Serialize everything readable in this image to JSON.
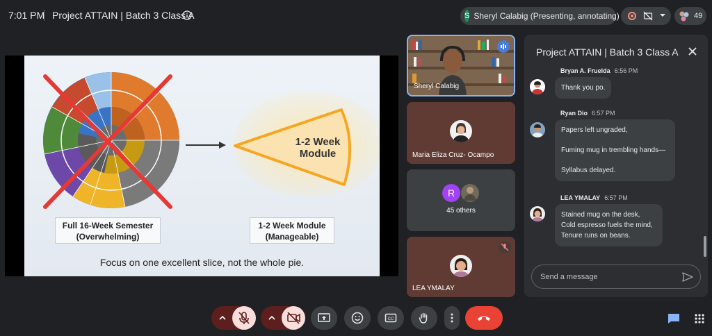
{
  "top_bar": {
    "time": "7:01 PM",
    "meeting_title": "Project ATTAIN | Batch 3 Class A",
    "presenter_initial": "S",
    "presenter_label": "Sheryl Calabig (Presenting, annotating)",
    "participant_count": "49"
  },
  "slide": {
    "left_label_line1": "Full 16-Week Semester",
    "left_label_line2": "(Overwhelming)",
    "module_line1": "1-2 Week",
    "module_line2": "Module",
    "right_label_line1": "1-2 Week Module",
    "right_label_line2": "(Manageable)",
    "caption": "Focus on one excellent slice, not the whole pie."
  },
  "tiles": [
    {
      "name": "Sheryl Calabig"
    },
    {
      "name": "Maria Eliza Cruz- Ocampo"
    },
    {
      "name": "45 others",
      "initial": "R"
    },
    {
      "name": "LEA YMALAY"
    }
  ],
  "chat": {
    "title": "Project ATTAIN | Batch 3 Class A",
    "messages": [
      {
        "sender": "Bryan A. Fruelda",
        "time": "6:56 PM",
        "lines": [
          "Thank you po."
        ]
      },
      {
        "sender": "Ryan Dio",
        "time": "6:57 PM",
        "lines": [
          "Papers left ungraded,",
          "Fuming mug in trembling hands—",
          "Syllabus delayed."
        ]
      },
      {
        "sender": "LEA YMALAY",
        "time": "6:57 PM",
        "lines": [
          "Stained mug on the desk,",
          "Cold espresso fuels the mind,",
          "Tenure runs on beans."
        ]
      }
    ],
    "input_placeholder": "Send a message"
  },
  "colors": {
    "accent": "#8ab4f8",
    "end_call": "#ea4335",
    "muted_bg": "#f9dedc",
    "annotation_red": "#e53935"
  },
  "icons": [
    "info-icon",
    "record-icon",
    "captions-off-icon",
    "chevron-down-icon",
    "close-icon",
    "send-icon",
    "mic-off-icon",
    "camera-off-icon",
    "present-icon",
    "emoji-icon",
    "captions-icon",
    "raise-hand-icon",
    "more-icon",
    "end-call-icon",
    "chat-icon",
    "activities-icon"
  ]
}
